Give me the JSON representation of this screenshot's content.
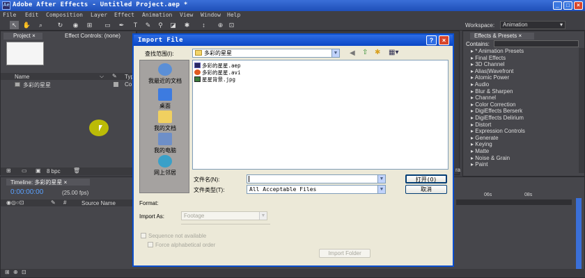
{
  "app": {
    "title": "Adobe After Effects - Untitled Project.aep *"
  },
  "menu": [
    "File",
    "Edit",
    "Composition",
    "Layer",
    "Effect",
    "Animation",
    "View",
    "Window",
    "Help"
  ],
  "toolbar": {
    "workspace_label": "Workspace:",
    "workspace_value": "Animation"
  },
  "project_panel": {
    "tab": "Project",
    "effect_controls_tab": "Effect Controls: (none)",
    "col_name": "Name",
    "col_type": "Typ",
    "items": [
      {
        "name": "多彩的星星",
        "type": "Co"
      }
    ],
    "bpc": "8 bpc"
  },
  "effects_panel": {
    "tab": "Effects & Presets",
    "contains_label": "Contains:",
    "items": [
      "* Animation Presets",
      "Final Effects",
      "3D Channel",
      "Alias|Wavefront",
      "Atomic Power",
      "Audio",
      "Blur & Sharpen",
      "Channel",
      "Color Correction",
      "DigiEffects Berserk",
      "DigiEffects Delirium",
      "Distort",
      "Expression Controls",
      "Generate",
      "Keying",
      "Matte",
      "Noise & Grain",
      "Paint"
    ],
    "partial_label": "ra"
  },
  "timeline": {
    "tab": "Timeline: 多彩的星星",
    "timecode": "0:00:00:00",
    "fps": "(25.00 fps)",
    "source_name": "Source Name",
    "ruler_06s": "06s",
    "ruler_08s": "08s"
  },
  "dialog": {
    "title": "Import File",
    "lookin_label": "查找范围(I):",
    "lookin_value": "多彩的星星",
    "places": [
      "我最近的文档",
      "桌面",
      "我的文档",
      "我的电脑",
      "网上邻居"
    ],
    "files": [
      "多彩的星星.aep",
      "多彩的星星.avi",
      "星星背景.jpg"
    ],
    "filename_label": "文件名(N):",
    "filename_value": "",
    "filetype_label": "文件类型(T):",
    "filetype_value": "All Acceptable Files",
    "open_button": "打开(O)",
    "cancel_button": "取消",
    "format_label": "Format:",
    "import_as_label": "Import As:",
    "import_as_value": "Footage",
    "sequence_label": "Sequence not available",
    "force_alpha_label": "Force alphabetical order",
    "import_folder_button": "Import Folder"
  },
  "colors": {
    "dialog_bg": "#ece9d8",
    "title_blue": "#0a47c5",
    "app_bg": "#3f3f44",
    "timecode": "#5aa0ff"
  }
}
